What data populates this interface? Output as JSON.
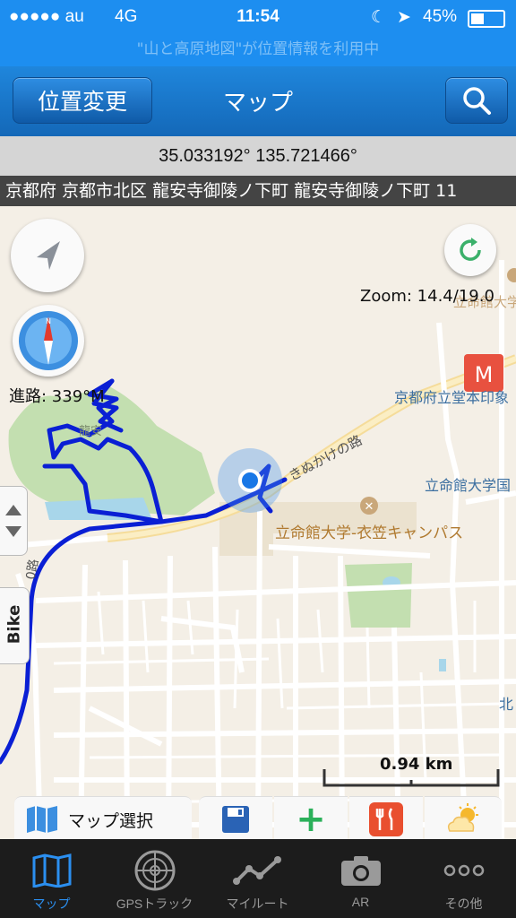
{
  "status": {
    "carrier": "●●●●● au",
    "network": "4G",
    "time": "11:54",
    "battery": "45%"
  },
  "location_banner": "\"山と高原地図\"が位置情報を利用中",
  "nav": {
    "left_button": "位置変更",
    "title": "マップ"
  },
  "coordinates": "35.033192° 135.721466°",
  "address": "京都府 京都市北区 龍安寺御陵ノ下町 龍安寺御陵ノ下町 11",
  "map": {
    "zoom_text": "Zoom: 14.4/19.0",
    "heading_text": "進路: 339°M",
    "bike_label": "Bike",
    "scale_label": "0.94 km",
    "labels": {
      "school_top": "立命館大学",
      "museum": "京都府立堂本印象",
      "uni_school": "立命館大学国",
      "campus": "立命館大学-衣笠キャンパス",
      "road": "きぬかけの路",
      "pond": "龍安",
      "north": "北",
      "left_road": "0路"
    }
  },
  "tools": {
    "map_select": "マップ選択"
  },
  "tabs": [
    {
      "label": "マップ",
      "icon": "map-icon"
    },
    {
      "label": "GPSトラック",
      "icon": "radar-icon"
    },
    {
      "label": "マイルート",
      "icon": "route-icon"
    },
    {
      "label": "AR",
      "icon": "camera-icon"
    },
    {
      "label": "その他",
      "icon": "more-icon"
    }
  ],
  "colors": {
    "accent": "#1d8ef0",
    "track": "#0a1fd4",
    "tab_active": "#2b8ff0"
  }
}
